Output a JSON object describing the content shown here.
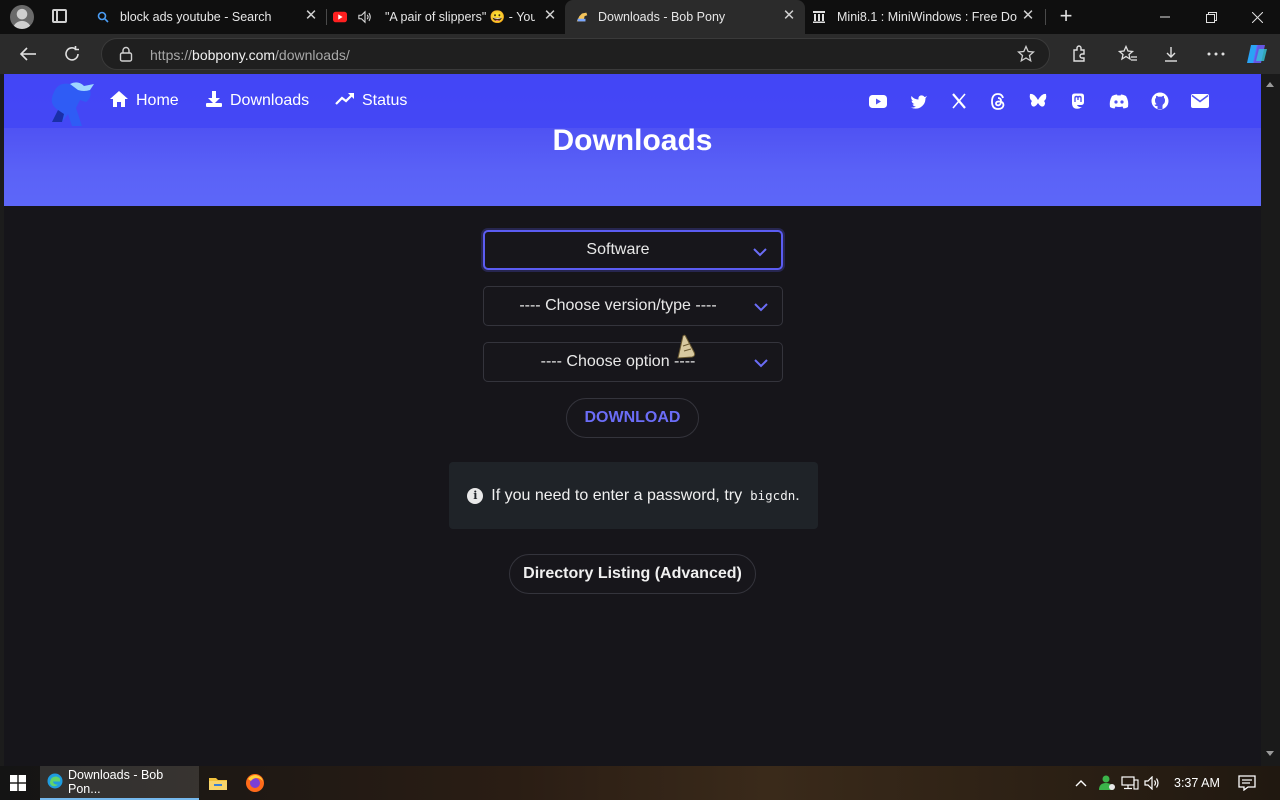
{
  "browser": {
    "tabs": [
      {
        "title": "block ads youtube - Search",
        "favicon": "search-favicon"
      },
      {
        "title": "\"A pair of slippers\" 😀 - You",
        "favicon": "youtube-favicon",
        "audio": "speaker-icon"
      },
      {
        "title": "Downloads - Bob Pony",
        "favicon": "bobpony-favicon",
        "active": true
      },
      {
        "title": "Mini8.1 : MiniWindows : Free Dow",
        "favicon": "archive-favicon"
      }
    ],
    "url": {
      "prefix": "https://",
      "host": "bobpony.com",
      "path": "/downloads/"
    }
  },
  "site": {
    "nav": [
      {
        "label": "Home",
        "icon": "home-icon"
      },
      {
        "label": "Downloads",
        "icon": "download-icon"
      },
      {
        "label": "Status",
        "icon": "trending-up-icon"
      }
    ],
    "social_icons": [
      "youtube-icon",
      "twitter-icon",
      "x-icon",
      "threads-icon",
      "bluesky-icon",
      "mastodon-icon",
      "discord-icon",
      "github-icon",
      "mail-icon"
    ],
    "title": "Downloads"
  },
  "form": {
    "category": "Software",
    "version": "---- Choose version/type ----",
    "option": "---- Choose option ----",
    "download_label": "DOWNLOAD",
    "note_text": "If you need to enter a password, try",
    "note_code": "bigcdn",
    "note_end": ".",
    "directory_label": "Directory Listing (Advanced)"
  },
  "taskbar": {
    "active_app": "Downloads - Bob Pon...",
    "clock": "3:37 AM"
  },
  "colors": {
    "accent": "#5b5cf2",
    "hero": "#4f52f3",
    "page_bg": "#16151a"
  }
}
